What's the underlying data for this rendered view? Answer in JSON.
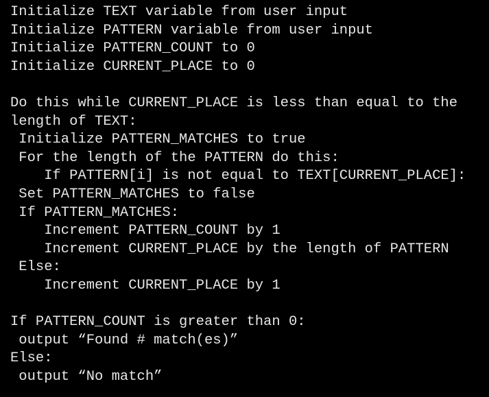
{
  "document": {
    "lines": [
      "Initialize TEXT variable from user input",
      "Initialize PATTERN variable from user input",
      "Initialize PATTERN_COUNT to 0",
      "Initialize CURRENT_PLACE to 0",
      "",
      "Do this while CURRENT_PLACE is less than equal to the",
      "length of TEXT:",
      " Initialize PATTERN_MATCHES to true",
      " For the length of the PATTERN do this:",
      "    If PATTERN[i] is not equal to TEXT[CURRENT_PLACE]:",
      " Set PATTERN_MATCHES to false",
      " If PATTERN_MATCHES:",
      "    Increment PATTERN_COUNT by 1",
      "    Increment CURRENT_PLACE by the length of PATTERN",
      " Else:",
      "    Increment CURRENT_PLACE by 1",
      "",
      "If PATTERN_COUNT is greater than 0:",
      " output “Found # match(es)”",
      "Else:",
      " output “No match”"
    ]
  },
  "colors": {
    "background": "#000000",
    "text": "#e6e6e6"
  }
}
